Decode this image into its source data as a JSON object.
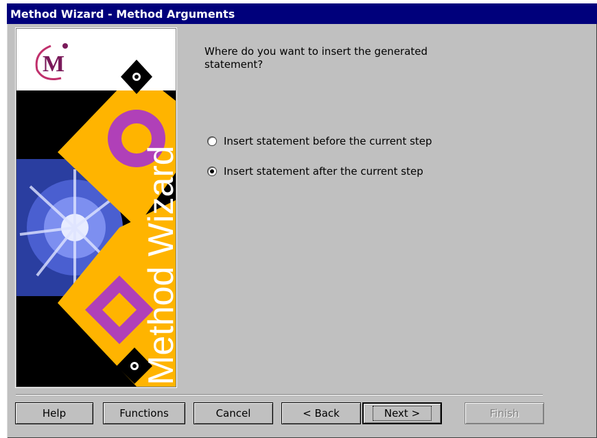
{
  "window": {
    "title": "Method Wizard - Method Arguments"
  },
  "banner": {
    "logo_text": "M",
    "vertical_text": "Method Wizard"
  },
  "main": {
    "prompt": "Where do you want to insert the generated statement?",
    "options": [
      {
        "label": "Insert statement before the current step",
        "checked": false
      },
      {
        "label": "Insert statement after the current step",
        "checked": true
      }
    ]
  },
  "buttons": {
    "help": "Help",
    "functions": "Functions",
    "cancel": "Cancel",
    "back": "< Back",
    "next": "Next >",
    "finish": "Finish"
  },
  "colors": {
    "title_bar": "#00007b",
    "dialog_bg": "#c0c0c0",
    "banner_gold": "#ffb400",
    "banner_purple": "#b040b8"
  }
}
